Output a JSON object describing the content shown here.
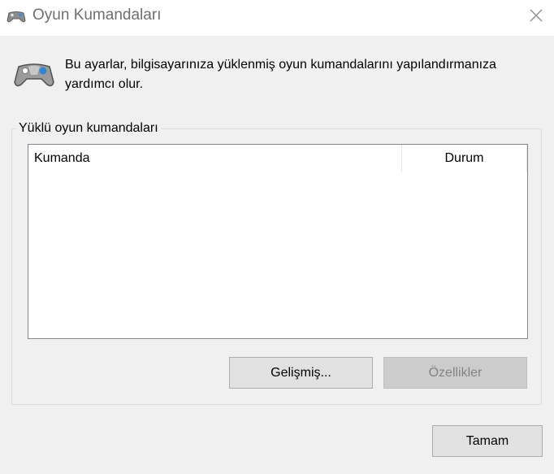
{
  "window": {
    "title": "Oyun Kumandaları"
  },
  "description": "Bu ayarlar, bilgisayarınıza yüklenmiş oyun kumandalarını yapılandırmanıza yardımcı olur.",
  "group": {
    "label": "Yüklü oyun kumandaları",
    "columns": [
      "Kumanda",
      "Durum"
    ],
    "rows": []
  },
  "buttons": {
    "advanced": "Gelişmiş...",
    "properties": "Özellikler",
    "ok": "Tamam"
  },
  "icons": {
    "title": "game-controller-icon",
    "header": "game-controller-icon",
    "close": "close-icon"
  },
  "colors": {
    "background": "#f0f0f0",
    "titlebar": "#ffffff",
    "button": "#e1e1e1",
    "button_disabled": "#cccccc",
    "text_disabled": "#838383"
  }
}
